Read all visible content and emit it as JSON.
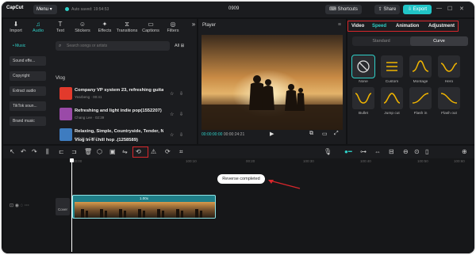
{
  "app": {
    "logo": "CapCut",
    "menu_label": "Menu",
    "autosave": "Auto saved: 19:54:53",
    "project_title": "0909",
    "shortcuts": "Shortcuts",
    "share": "Share",
    "export": "Export"
  },
  "library": {
    "tabs": [
      {
        "label": "Import",
        "icon": "import-icon"
      },
      {
        "label": "Audio",
        "icon": "audio-icon"
      },
      {
        "label": "Text",
        "icon": "text-icon"
      },
      {
        "label": "Stickers",
        "icon": "stickers-icon"
      },
      {
        "label": "Effects",
        "icon": "effects-icon"
      },
      {
        "label": "Transitions",
        "icon": "transitions-icon"
      },
      {
        "label": "Captions",
        "icon": "captions-icon"
      },
      {
        "label": "Filters",
        "icon": "filters-icon"
      }
    ],
    "side": [
      "• Music",
      "Sound effe...",
      "Copyright",
      "Extract audio",
      "TikTok soun...",
      "Brand music"
    ],
    "search_placeholder": "Search songs or artists",
    "filter_label": "All",
    "section_title": "Vlog",
    "tracks": [
      {
        "title": "Company VP system 23, refreshing guita...",
        "meta": "Yearbeng · 00:41",
        "color": "#e23a2c"
      },
      {
        "title": "Refreshing and light indie pop(1552207)",
        "meta": "Chang Lee · 02:39",
        "color": "#9a4aa8"
      },
      {
        "title": "Relaxing, Simple, Countryside, Tender, N...",
        "meta": "E.D.M. · 02:57",
        "color": "#3e7cc0"
      },
      {
        "title": "Vlog  In-fi chill hop .(1258589)",
        "meta": "",
        "color": "#5c8a4a"
      }
    ]
  },
  "player": {
    "title": "Player",
    "time_current": "00:00:00:00",
    "time_total": "00:00:24:21"
  },
  "properties": {
    "tabs": [
      "Video",
      "Speed",
      "Animation",
      "Adjustment"
    ],
    "active_tab": "Speed",
    "sub_tabs": [
      "Standard",
      "Curve"
    ],
    "curves": [
      "None",
      "Custom",
      "Montage",
      "Hero",
      "Bullet",
      "Jump cut",
      "Flash in",
      "Flash out"
    ]
  },
  "timeline": {
    "ticks": [
      "00:00",
      "100:10",
      "00:20",
      "100:30",
      "100:40",
      "100:50",
      "100:60"
    ],
    "toast": "Reverse completed",
    "clip_speed": "1.00x",
    "cover_label": "Cover"
  },
  "colors": {
    "accent": "#2fd0c8",
    "highlight": "#d8262b"
  }
}
